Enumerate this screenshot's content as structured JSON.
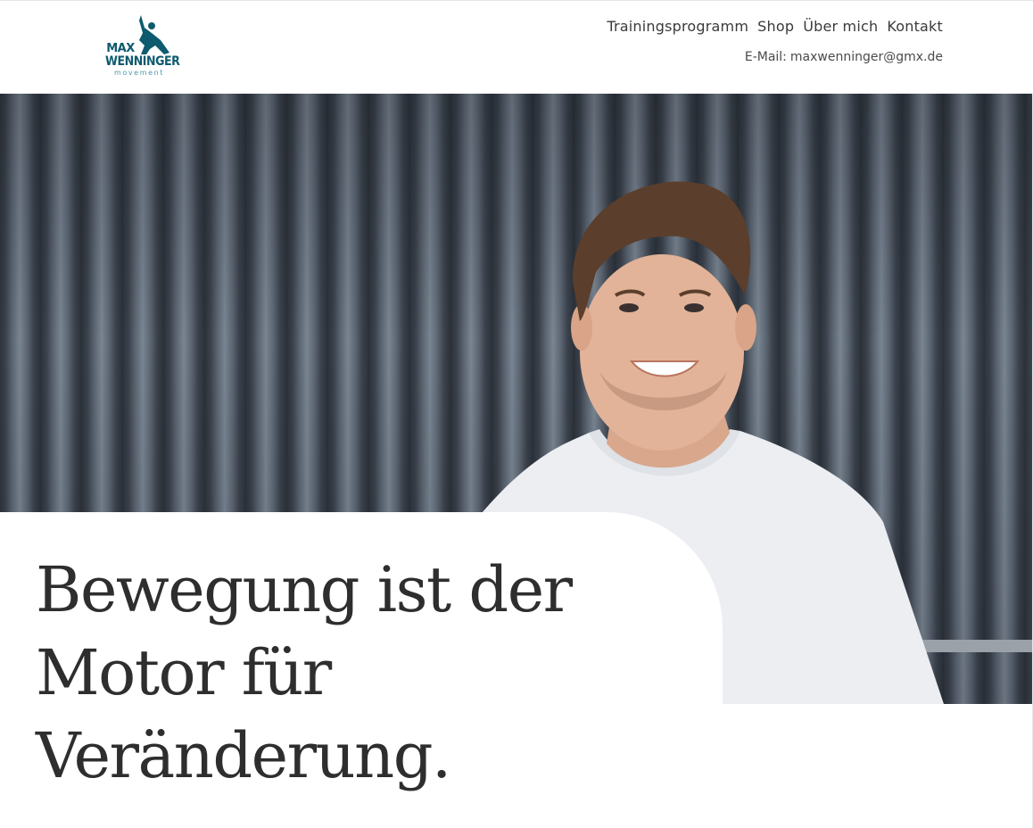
{
  "brand": {
    "line1": "MAX",
    "line2": "WENNINGER",
    "line3": "movement",
    "color": "#0e5a6e"
  },
  "nav": {
    "items": [
      "Trainingsprogramm",
      "Shop",
      "Über mich",
      "Kontakt"
    ]
  },
  "contact": {
    "email_label": "E-Mail:",
    "email": "maxwenninger@gmx.de"
  },
  "hero": {
    "image": "portrait-photo",
    "headline": [
      "Bewegung ist der",
      "Motor für",
      "Veränderung."
    ]
  }
}
